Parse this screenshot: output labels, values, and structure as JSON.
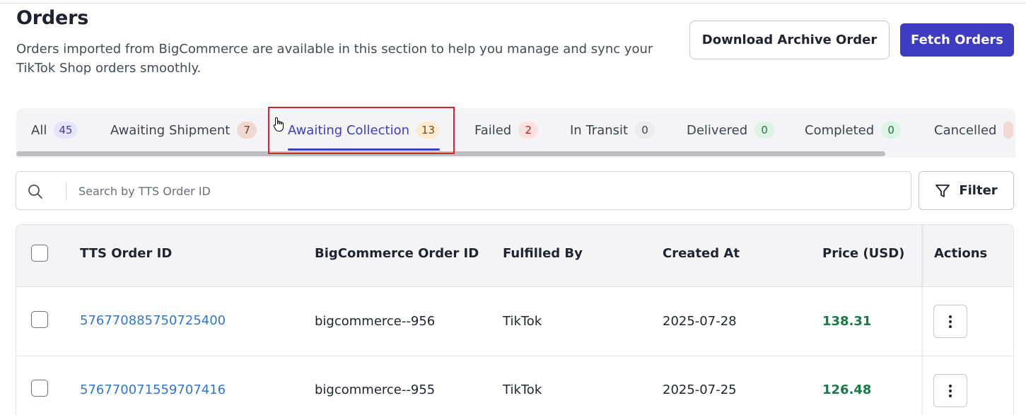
{
  "header": {
    "title": "Orders",
    "description": "Orders imported from BigCommerce are available in this section to help you manage and sync your TikTok Shop orders smoothly.",
    "download_label": "Download Archive Order",
    "fetch_label": "Fetch Orders"
  },
  "tabs": [
    {
      "label": "All",
      "count": "45",
      "color": "purple"
    },
    {
      "label": "Awaiting Shipment",
      "count": "7",
      "color": "brown"
    },
    {
      "label": "Awaiting Collection",
      "count": "13",
      "color": "orange",
      "active": true
    },
    {
      "label": "Failed",
      "count": "2",
      "color": "red"
    },
    {
      "label": "In Transit",
      "count": "0",
      "color": "gray"
    },
    {
      "label": "Delivered",
      "count": "0",
      "color": "green"
    },
    {
      "label": "Completed",
      "count": "0",
      "color": "green"
    },
    {
      "label": "Cancelled",
      "count": "",
      "color": "brown"
    }
  ],
  "search": {
    "placeholder": "Search by TTS Order ID",
    "value": ""
  },
  "filter_label": "Filter",
  "table": {
    "columns": [
      "TTS Order ID",
      "BigCommerce Order ID",
      "Fulfilled By",
      "Created At",
      "Price (USD)",
      "Actions"
    ],
    "rows": [
      {
        "tts_id": "576770885750725400",
        "bc_id": "bigcommerce--956",
        "fulfilled_by": "TikTok",
        "created_at": "2025-07-28",
        "price": "138.31"
      },
      {
        "tts_id": "576770071559707416",
        "bc_id": "bigcommerce--955",
        "fulfilled_by": "TikTok",
        "created_at": "2025-07-25",
        "price": "126.48"
      }
    ]
  },
  "colors": {
    "primary": "#3f3ac2",
    "link": "#2f76d2",
    "price": "#1a7a46",
    "highlight": "#d8232a"
  }
}
